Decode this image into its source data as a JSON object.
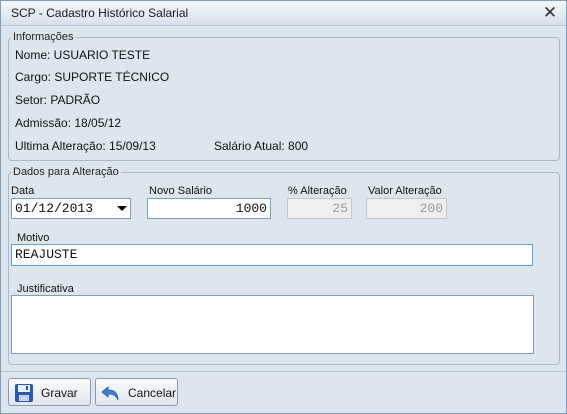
{
  "window": {
    "title": "SCP - Cadastro Histórico Salarial"
  },
  "info": {
    "legend": "Informações",
    "nome": "Nome: USUARIO TESTE",
    "cargo": "Cargo: SUPORTE TÉCNICO",
    "setor": "Setor: PADRÃO",
    "admissao": "Admissão: 18/05/12",
    "ultima_alteracao": "Ultima Alteração: 15/09/13",
    "salario_atual": "Salário Atual: 800"
  },
  "form": {
    "legend": "Dados para Alteração",
    "data_label": "Data",
    "data_value": "01/12/2013",
    "novo_salario_label": "Novo Salário",
    "novo_salario_value": "1000",
    "pct_alteracao_label": "% Alteração",
    "pct_alteracao_value": "25",
    "valor_alteracao_label": "Valor Alteração",
    "valor_alteracao_value": "200",
    "motivo_label": "Motivo",
    "motivo_value": "REAJUSTE",
    "justificativa_label": "Justificativa",
    "justificativa_value": ""
  },
  "buttons": {
    "gravar": "Gravar",
    "cancelar": "Cancelar"
  },
  "icons": {
    "close": "close-icon",
    "gravar": "floppy-disk-icon",
    "cancelar": "undo-arrow-icon"
  },
  "colors": {
    "window_bg": "#dde6ef",
    "border": "#7f9db9",
    "floppy": "#2a5aa8",
    "undo": "#3a7fd0"
  }
}
